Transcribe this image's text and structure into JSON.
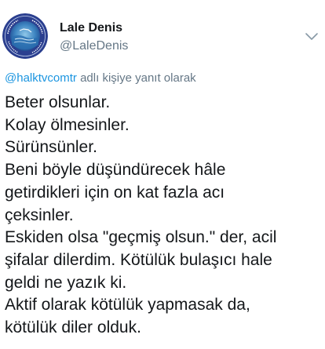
{
  "author": {
    "display_name": "Lale Denis",
    "handle": "@LaleDenis",
    "avatar_icon": "profile-avatar-seal"
  },
  "menu": {
    "icon": "chevron-down-icon"
  },
  "reply": {
    "mention": "@halktvcomtr",
    "suffix": " adlı kişiye yanıt olarak"
  },
  "body": {
    "lines": [
      "Beter olsunlar.",
      "Kolay ölmesinler.",
      "Sürünsünler.",
      "Beni böyle düşündürecek hâle",
      "getirdikleri için on kat fazla acı",
      "çeksinler.",
      "Eskiden olsa \"geçmiş olsun.\" der, acil",
      "şifalar dilerdim. Kötülük bulaşıcı hale",
      "geldi ne yazık ki.",
      "Aktif olarak kötülük yapmasak da,",
      "kötülük diler olduk."
    ]
  },
  "colors": {
    "text": "#14171a",
    "secondary": "#657786",
    "link": "#1b95e0",
    "avatar_bg": "#2b3f8f"
  }
}
